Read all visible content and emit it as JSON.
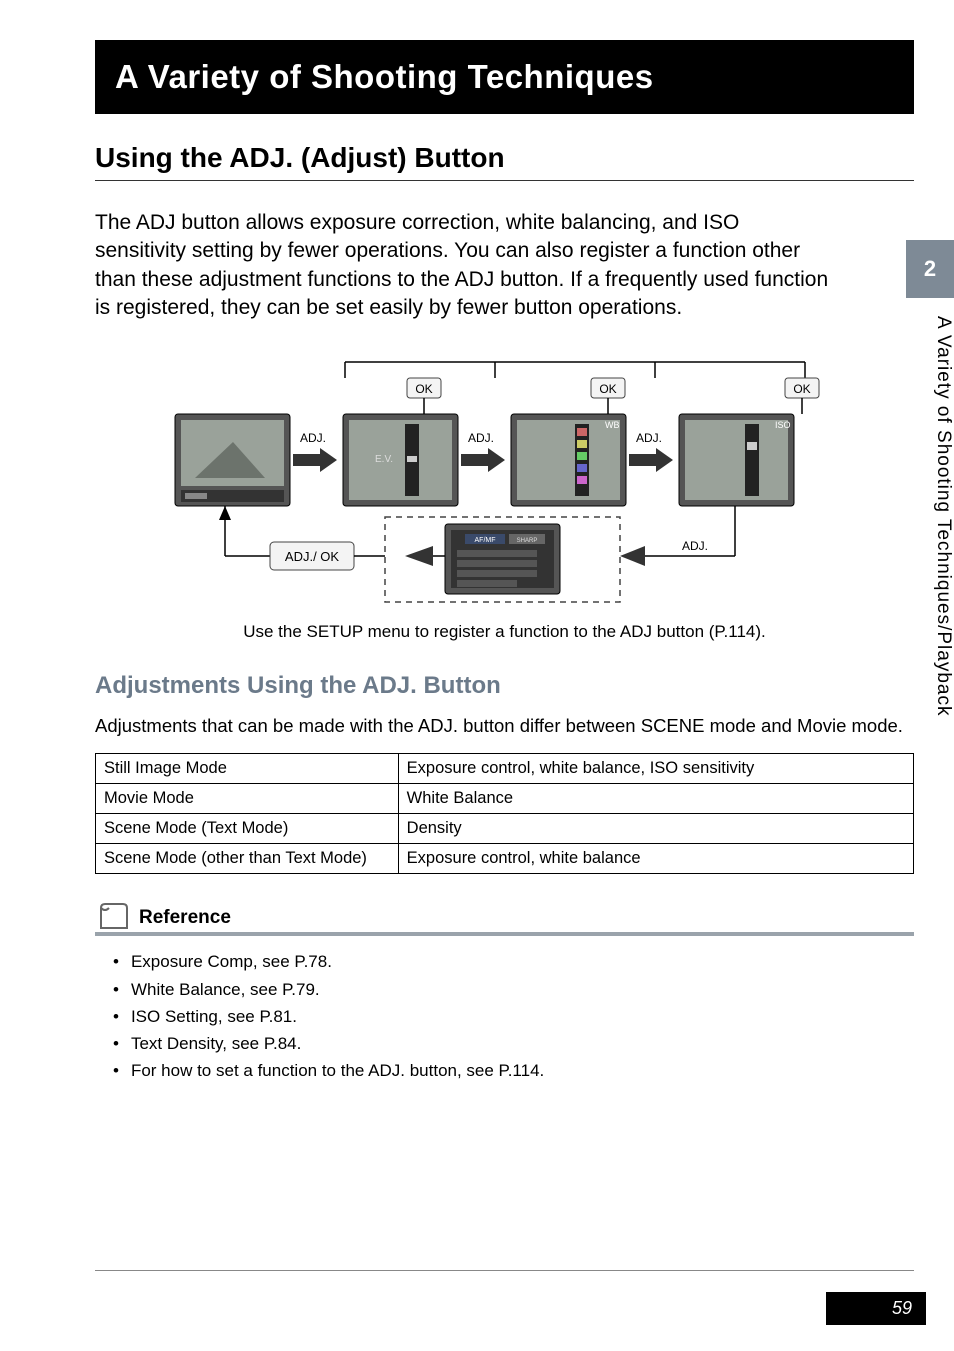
{
  "chapter_banner": "A Variety of Shooting Techniques",
  "section_title": "Using the ADJ. (Adjust) Button",
  "intro_paragraph": "The ADJ button allows exposure correction, white balancing, and ISO sensitivity setting by fewer operations. You can also register a function other than these adjustment functions to the ADJ button. If a frequently used function is registered, they can be set easily by fewer button operations.",
  "diagram": {
    "adj_label": "ADJ.",
    "ok_label": "OK",
    "adj_ok_label": "ADJ./ OK",
    "caption": "Use the SETUP menu to register a function to the ADJ button (P.114)."
  },
  "sub_heading": "Adjustments Using the ADJ. Button",
  "sub_paragraph": "Adjustments that can be made with the ADJ. button differ between SCENE mode and Movie mode.",
  "modes_table": [
    {
      "mode": "Still Image Mode",
      "settings": "Exposure control, white balance, ISO sensitivity"
    },
    {
      "mode": "Movie Mode",
      "settings": "White Balance"
    },
    {
      "mode": "Scene Mode (Text Mode)",
      "settings": "Density"
    },
    {
      "mode": "Scene Mode (other than Text Mode)",
      "settings": "Exposure control, white balance"
    }
  ],
  "reference": {
    "label": "Reference",
    "items": [
      "Exposure Comp, see P.78.",
      "White Balance, see P.79.",
      "ISO Setting, see P.81.",
      "Text Density, see P.84.",
      "For how to set a function to the ADJ. button, see P.114."
    ]
  },
  "side_tab": {
    "number": "2",
    "text": "A Variety of Shooting Techniques/Playback"
  },
  "page_number": "59"
}
